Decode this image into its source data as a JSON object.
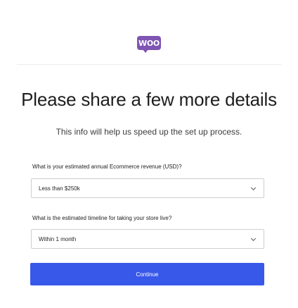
{
  "header": {
    "logo_text": "WOO",
    "logo_color": "#7f54b3"
  },
  "main": {
    "title": "Please share a few more details",
    "subtitle": "This info will help us speed up the set up process."
  },
  "form": {
    "revenue": {
      "label": "What is your estimated annual Ecommerce revenue (USD)?",
      "value": "Less than $250k"
    },
    "timeline": {
      "label": "What is the estimated timeline for taking your store live?",
      "value": "Within 1 month"
    },
    "continue_label": "Continue",
    "accent": "#3858e9"
  }
}
